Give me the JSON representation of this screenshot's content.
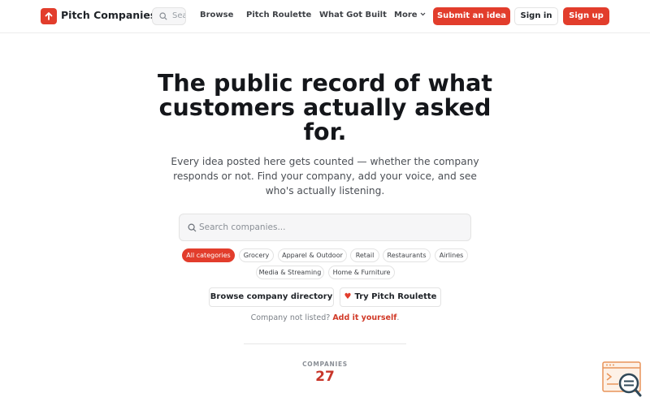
{
  "brand": {
    "name": "Pitch Companies",
    "icon": "arrow-up-icon",
    "color": "#e23d2c"
  },
  "header": {
    "search_placeholder": "Search",
    "nav": [
      "Browse",
      "Pitch Roulette",
      "What Got Built"
    ],
    "more_label": "More",
    "submit_label": "Submit an idea",
    "signin_label": "Sign in",
    "signup_label": "Sign up"
  },
  "hero": {
    "title": "The public record of what customers actually asked for.",
    "subtitle": "Every idea posted here gets counted — whether the company responds or not. Find your company, add your voice, and see who's actually listening."
  },
  "search": {
    "placeholder": "Search companies..."
  },
  "categories": [
    {
      "label": "All categories",
      "active": true
    },
    {
      "label": "Grocery",
      "active": false
    },
    {
      "label": "Apparel & Outdoor",
      "active": false
    },
    {
      "label": "Retail",
      "active": false
    },
    {
      "label": "Restaurants",
      "active": false
    },
    {
      "label": "Airlines",
      "active": false
    },
    {
      "label": "Media & Streaming",
      "active": false
    },
    {
      "label": "Home & Furniture",
      "active": false
    }
  ],
  "actions": {
    "browse_label": "Browse company directory",
    "roulette_label": "Try Pitch Roulette"
  },
  "not_listed": {
    "prefix": "Company not listed?",
    "link": "Add it yourself",
    "suffix": "."
  },
  "stats": {
    "label": "COMPANIES",
    "value": "27"
  },
  "colors": {
    "accent": "#e23d2c",
    "stat_value": "#c8362a"
  }
}
